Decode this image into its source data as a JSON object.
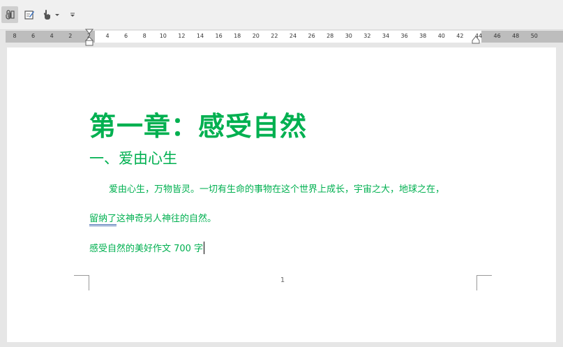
{
  "toolbar": {
    "items": [
      "attach-icon",
      "edit-doc-icon",
      "touch-mode-icon",
      "dropdown-icon",
      "customize-icon"
    ]
  },
  "ruler": {
    "ticks": [
      "8",
      "6",
      "4",
      "2",
      "2",
      "4",
      "6",
      "8",
      "10",
      "12",
      "14",
      "16",
      "18",
      "20",
      "22",
      "24",
      "26",
      "28",
      "30",
      "32",
      "34",
      "36",
      "38",
      "40",
      "42",
      "44",
      "46",
      "48",
      "50"
    ]
  },
  "document": {
    "heading1": "第一章：感受自然",
    "heading2": "一、爱由心生",
    "para1_line1": "爱由心生，万物皆灵。一切有生命的事物在这个世界上成长，宇宙之大，地球之在，",
    "para1_line2_underlined": "留纳了",
    "para1_line2_rest": "这神奇另人神往的自然。",
    "para2": "感受自然的美好作文 700 字",
    "page_number": "1"
  },
  "colors": {
    "heading": "#00b050",
    "text": "#00b050",
    "underline": "#4a6fb3"
  }
}
